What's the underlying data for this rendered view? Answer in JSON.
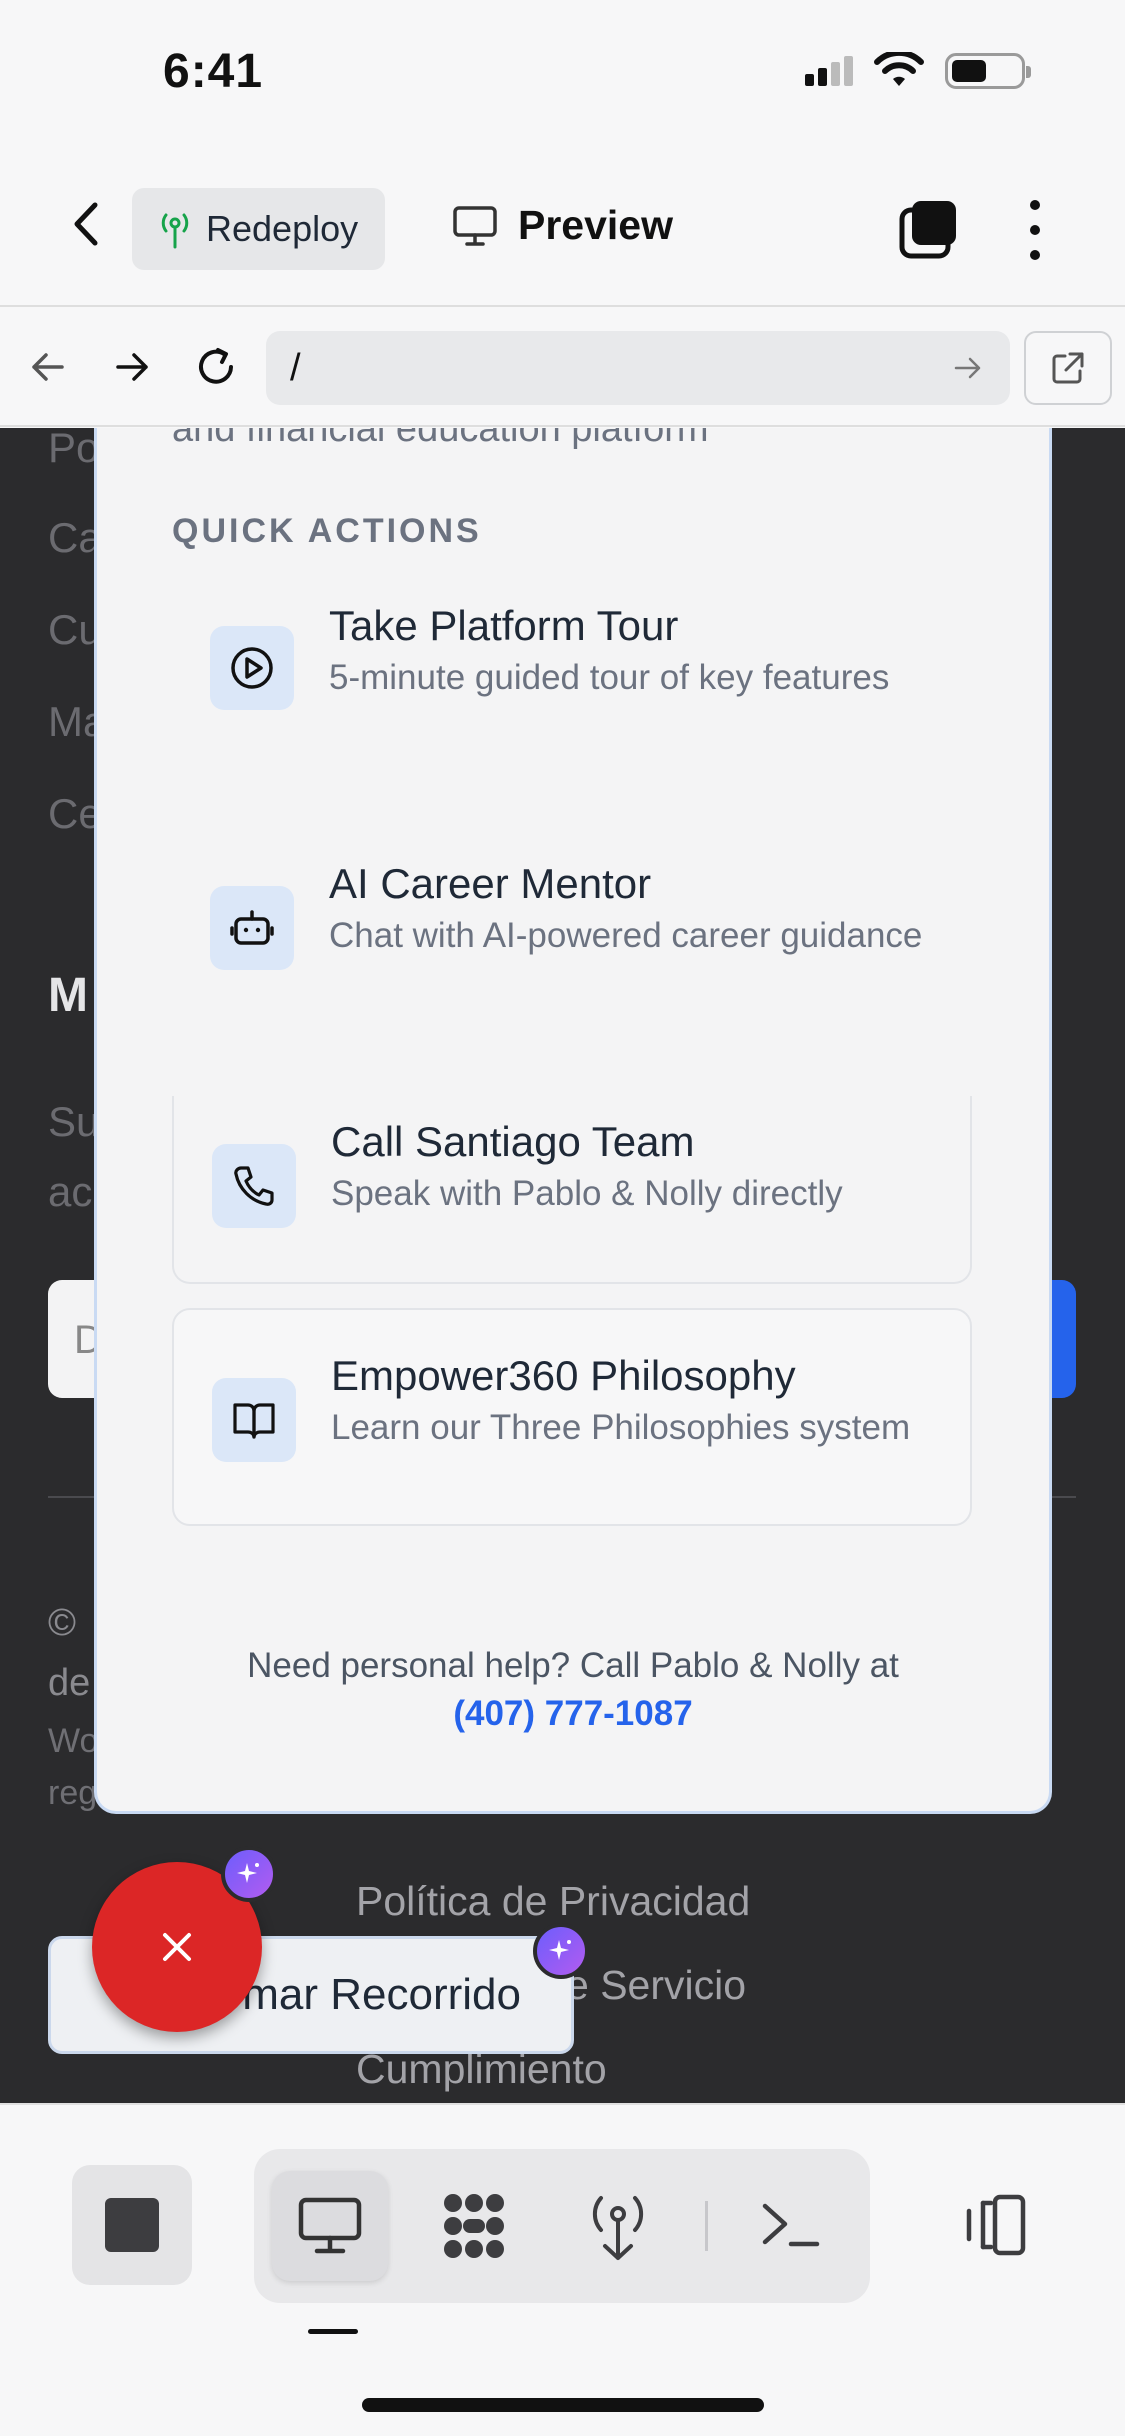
{
  "status_bar": {
    "time": "6:41"
  },
  "header": {
    "redeploy_label": "Redeploy",
    "preview_label": "Preview"
  },
  "browser": {
    "url": "/"
  },
  "background_page": {
    "partial_lines": [
      "Po",
      "Ca",
      "Cu",
      "Ma",
      "Ce"
    ],
    "heading_partial": "M",
    "sub_partial_1": "Su",
    "sub_partial_2": "ac",
    "input_partial": "D",
    "copyright_partial_1": "©",
    "copyright_partial_2": "de",
    "copyright_partial_3": "Wo",
    "copyright_partial_4": "reg",
    "footer_links": [
      "Política de Privacidad",
      "e Servicio",
      "Cumplimiento"
    ],
    "tour_button_label": "mar Recorrido"
  },
  "quick_actions": {
    "intro_text": "and financial education platform",
    "section_title": "QUICK ACTIONS",
    "actions": [
      {
        "title": "Take Platform Tour",
        "description": "5-minute guided tour of key features",
        "icon": "play-circle-icon"
      },
      {
        "title": "AI Career Mentor",
        "description": "Chat with AI-powered career guidance",
        "icon": "bot-icon"
      },
      {
        "title": "Call Santiago Team",
        "description": "Speak with Pablo & Nolly directly",
        "icon": "phone-icon"
      },
      {
        "title": "Empower360 Philosophy",
        "description": "Learn our Three Philosophies system",
        "icon": "book-open-icon"
      }
    ],
    "footer_text": "Need personal help? Call Pablo & Nolly at",
    "footer_phone": "(407) 777-1087"
  },
  "colors": {
    "accent": "#2563eb",
    "fab": "#dc2626",
    "icon_bg": "#dbe7f8",
    "dark_page": "#2b2b2d"
  }
}
